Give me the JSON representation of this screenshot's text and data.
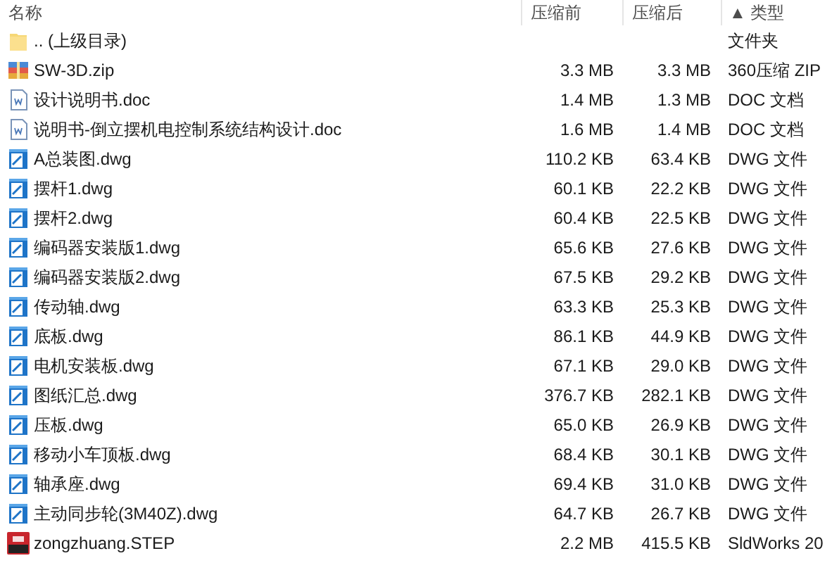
{
  "columns": [
    {
      "label": "名称"
    },
    {
      "label": "压缩前"
    },
    {
      "label": "压缩后"
    },
    {
      "label": "▲ 类型"
    }
  ],
  "rows": [
    {
      "kind": "folder",
      "name": ".. (上级目录)",
      "size": "",
      "packed": "",
      "type": "文件夹"
    },
    {
      "kind": "zip",
      "name": "SW-3D.zip",
      "size": "3.3 MB",
      "packed": "3.3 MB",
      "type": "360压缩 ZIP"
    },
    {
      "kind": "doc",
      "name": "设计说明书.doc",
      "size": "1.4 MB",
      "packed": "1.3 MB",
      "type": "DOC 文档"
    },
    {
      "kind": "doc",
      "name": "说明书-倒立摆机电控制系统结构设计.doc",
      "size": "1.6 MB",
      "packed": "1.4 MB",
      "type": "DOC 文档"
    },
    {
      "kind": "dwg",
      "name": "A总装图.dwg",
      "size": "110.2 KB",
      "packed": "63.4 KB",
      "type": "DWG 文件"
    },
    {
      "kind": "dwg",
      "name": "摆杆1.dwg",
      "size": "60.1 KB",
      "packed": "22.2 KB",
      "type": "DWG 文件"
    },
    {
      "kind": "dwg",
      "name": "摆杆2.dwg",
      "size": "60.4 KB",
      "packed": "22.5 KB",
      "type": "DWG 文件"
    },
    {
      "kind": "dwg",
      "name": "编码器安装版1.dwg",
      "size": "65.6 KB",
      "packed": "27.6 KB",
      "type": "DWG 文件"
    },
    {
      "kind": "dwg",
      "name": "编码器安装版2.dwg",
      "size": "67.5 KB",
      "packed": "29.2 KB",
      "type": "DWG 文件"
    },
    {
      "kind": "dwg",
      "name": "传动轴.dwg",
      "size": "63.3 KB",
      "packed": "25.3 KB",
      "type": "DWG 文件"
    },
    {
      "kind": "dwg",
      "name": "底板.dwg",
      "size": "86.1 KB",
      "packed": "44.9 KB",
      "type": "DWG 文件"
    },
    {
      "kind": "dwg",
      "name": "电机安装板.dwg",
      "size": "67.1 KB",
      "packed": "29.0 KB",
      "type": "DWG 文件"
    },
    {
      "kind": "dwg",
      "name": "图纸汇总.dwg",
      "size": "376.7 KB",
      "packed": "282.1 KB",
      "type": "DWG 文件"
    },
    {
      "kind": "dwg",
      "name": "压板.dwg",
      "size": "65.0 KB",
      "packed": "26.9 KB",
      "type": "DWG 文件"
    },
    {
      "kind": "dwg",
      "name": "移动小车顶板.dwg",
      "size": "68.4 KB",
      "packed": "30.1 KB",
      "type": "DWG 文件"
    },
    {
      "kind": "dwg",
      "name": "轴承座.dwg",
      "size": "69.4 KB",
      "packed": "31.0 KB",
      "type": "DWG 文件"
    },
    {
      "kind": "dwg",
      "name": "主动同步轮(3M40Z).dwg",
      "size": "64.7 KB",
      "packed": "26.7 KB",
      "type": "DWG 文件"
    },
    {
      "kind": "step",
      "name": "zongzhuang.STEP",
      "size": "2.2 MB",
      "packed": "415.5 KB",
      "type": "SldWorks 20"
    }
  ]
}
